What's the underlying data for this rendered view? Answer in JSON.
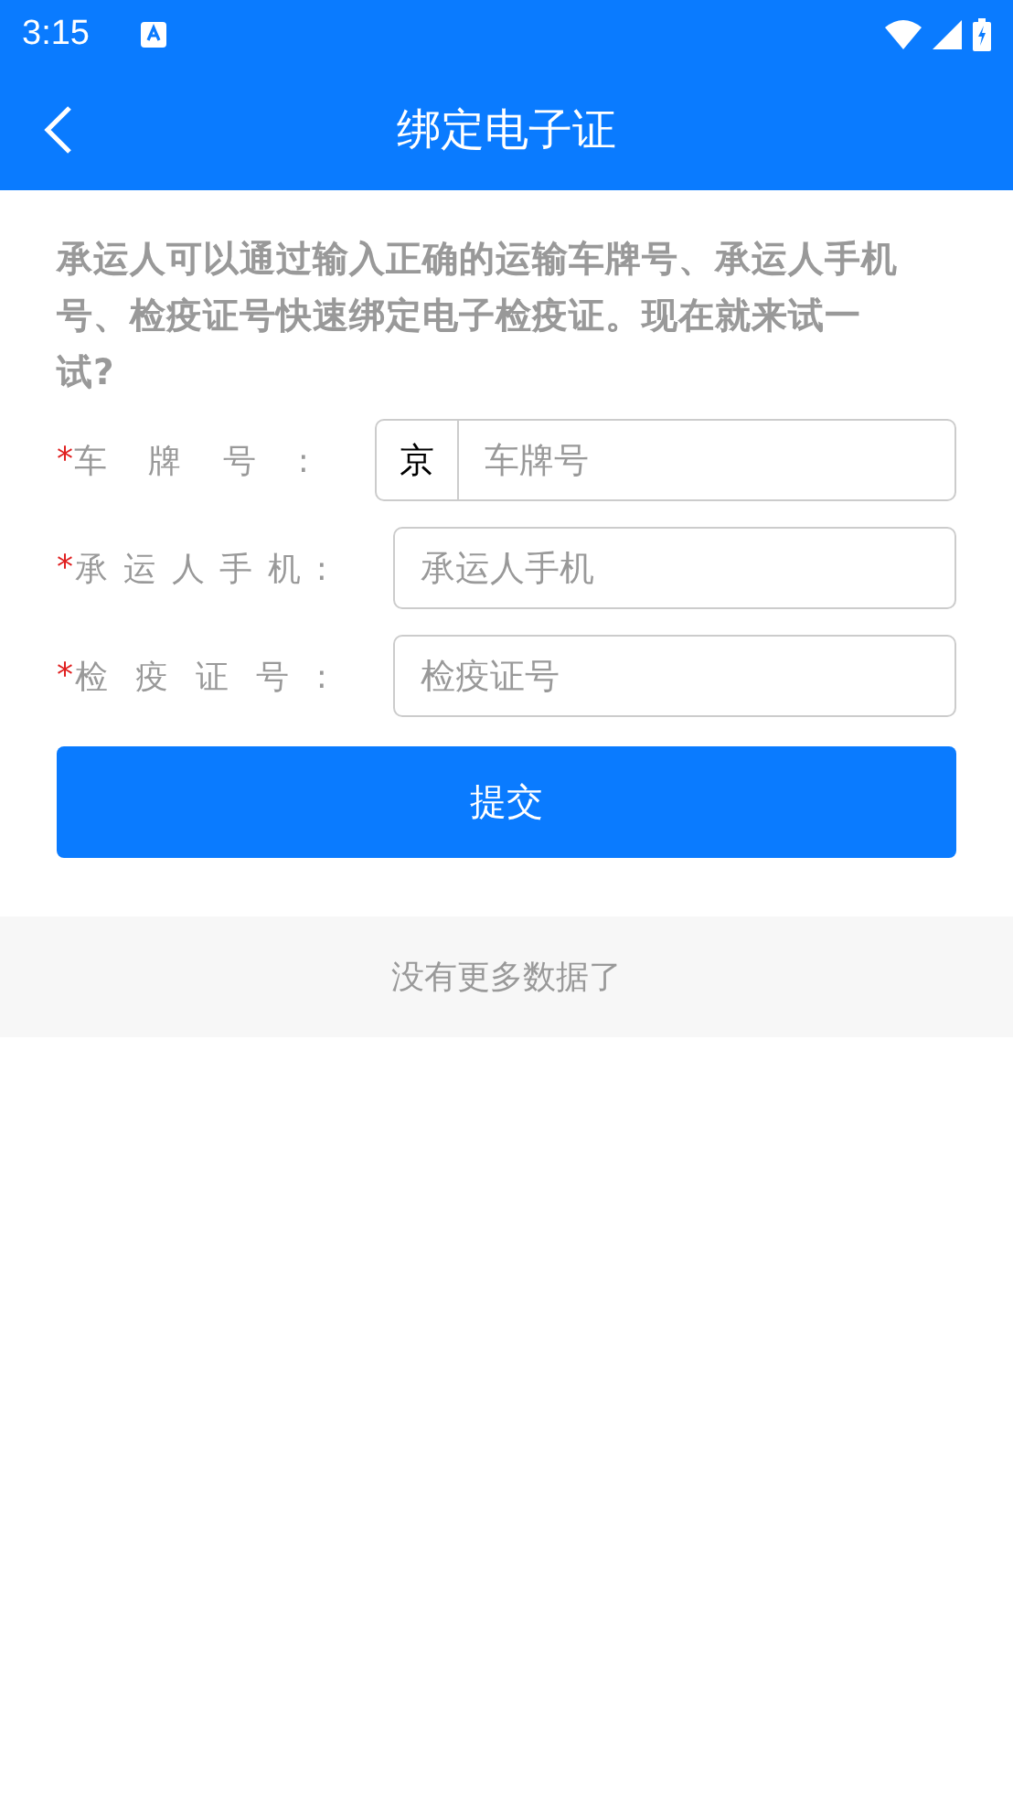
{
  "status_bar": {
    "time": "3:15"
  },
  "header": {
    "title": "绑定电子证"
  },
  "intro": "承运人可以通过输入正确的运输车牌号、承运人手机号、检疫证号快速绑定电子检疫证。现在就来试一试?",
  "fields": [
    {
      "mark": "*",
      "label": "车牌号:",
      "prefix": "京",
      "placeholder": "车牌号"
    },
    {
      "mark": "*",
      "label": "承运人手机:",
      "placeholder": "承运人手机"
    },
    {
      "mark": "*",
      "label": "检疫证号:",
      "placeholder": "检疫证号"
    }
  ],
  "submit": "提交",
  "footer": "没有更多数据了"
}
